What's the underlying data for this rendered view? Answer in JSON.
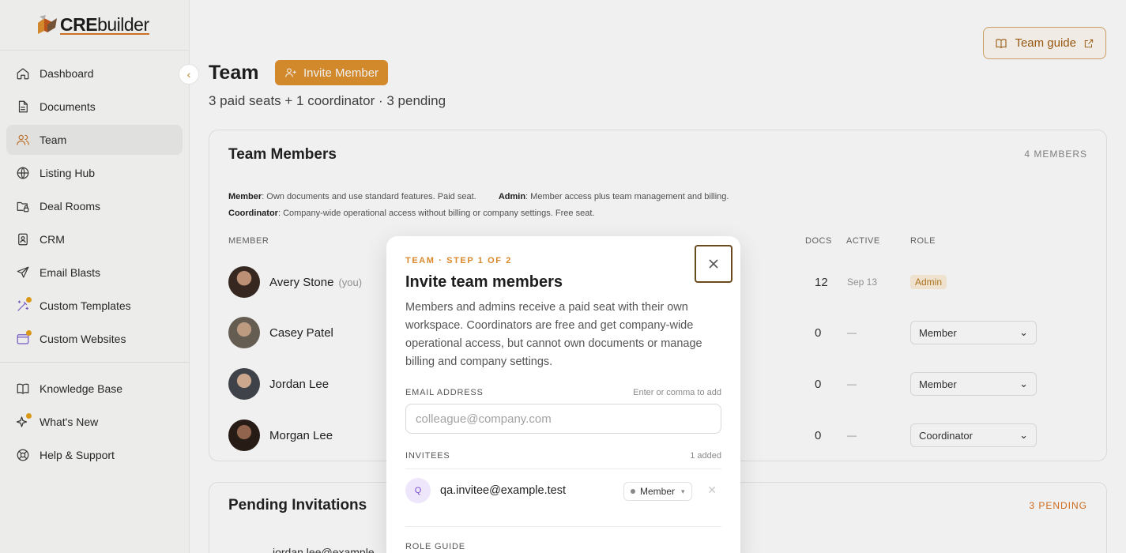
{
  "brand": {
    "name_bold": "CRE",
    "name_rest": "builder"
  },
  "sidebar": {
    "items": [
      {
        "label": "Dashboard",
        "icon": "home-icon"
      },
      {
        "label": "Documents",
        "icon": "document-icon"
      },
      {
        "label": "Team",
        "icon": "users-icon",
        "active": true
      },
      {
        "label": "Listing Hub",
        "icon": "globe-icon"
      },
      {
        "label": "Deal Rooms",
        "icon": "folder-lock-icon"
      },
      {
        "label": "CRM",
        "icon": "contact-icon"
      },
      {
        "label": "Email Blasts",
        "icon": "send-icon"
      },
      {
        "label": "Custom Templates",
        "icon": "wand-icon"
      },
      {
        "label": "Custom Websites",
        "icon": "browser-icon"
      }
    ],
    "footer_items": [
      {
        "label": "Knowledge Base",
        "icon": "book-icon"
      },
      {
        "label": "What's New",
        "icon": "sparkle-icon"
      },
      {
        "label": "Help & Support",
        "icon": "lifebuoy-icon"
      }
    ]
  },
  "header": {
    "title": "Team",
    "invite_label": "Invite Member",
    "subtitle": "3 paid seats + 1 coordinator · 3 pending",
    "guide_label": "Team guide"
  },
  "members_card": {
    "title": "Team Members",
    "count": "4 MEMBERS",
    "legend": {
      "member_term": "Member",
      "member_text": ": Own documents and use standard features. Paid seat.",
      "admin_term": "Admin",
      "admin_text": ": Member access plus team management and billing.",
      "coord_term": "Coordinator",
      "coord_text": ": Company-wide operational access without billing or company settings. Free seat."
    },
    "columns": {
      "member": "MEMBER",
      "docs": "DOCS",
      "active": "ACTIVE",
      "role": "ROLE"
    },
    "rows": [
      {
        "name": "Avery Stone",
        "you": "(you)",
        "docs": "12",
        "active": "Sep 13",
        "role": "Admin"
      },
      {
        "name": "Casey Patel",
        "docs": "0",
        "active": "—",
        "role": "Member"
      },
      {
        "name": "Jordan Lee",
        "docs": "0",
        "active": "—",
        "role": "Member"
      },
      {
        "name": "Morgan Lee",
        "docs": "0",
        "active": "—",
        "role": "Coordinator"
      }
    ]
  },
  "pending_card": {
    "title": "Pending Invitations",
    "count": "3 PENDING",
    "first_email": "jordan.lee@example"
  },
  "modal": {
    "step": "TEAM · STEP 1 OF 2",
    "title": "Invite team members",
    "description": "Members and admins receive a paid seat with their own workspace. Coordinators are free and get company-wide operational access, but cannot own documents or manage billing and company settings.",
    "email_label": "EMAIL ADDRESS",
    "email_hint": "Enter or comma to add",
    "email_placeholder": "colleague@company.com",
    "invitees_label": "INVITEES",
    "invitees_count": "1 added",
    "invitees": [
      {
        "initial": "Q",
        "email": "qa.invitee@example.test",
        "role": "Member"
      }
    ],
    "role_guide_label": "ROLE GUIDE"
  },
  "colors": {
    "accent": "#e0922f",
    "accent_dark": "#a15d12",
    "active_nav_icon": "#c9762c"
  }
}
